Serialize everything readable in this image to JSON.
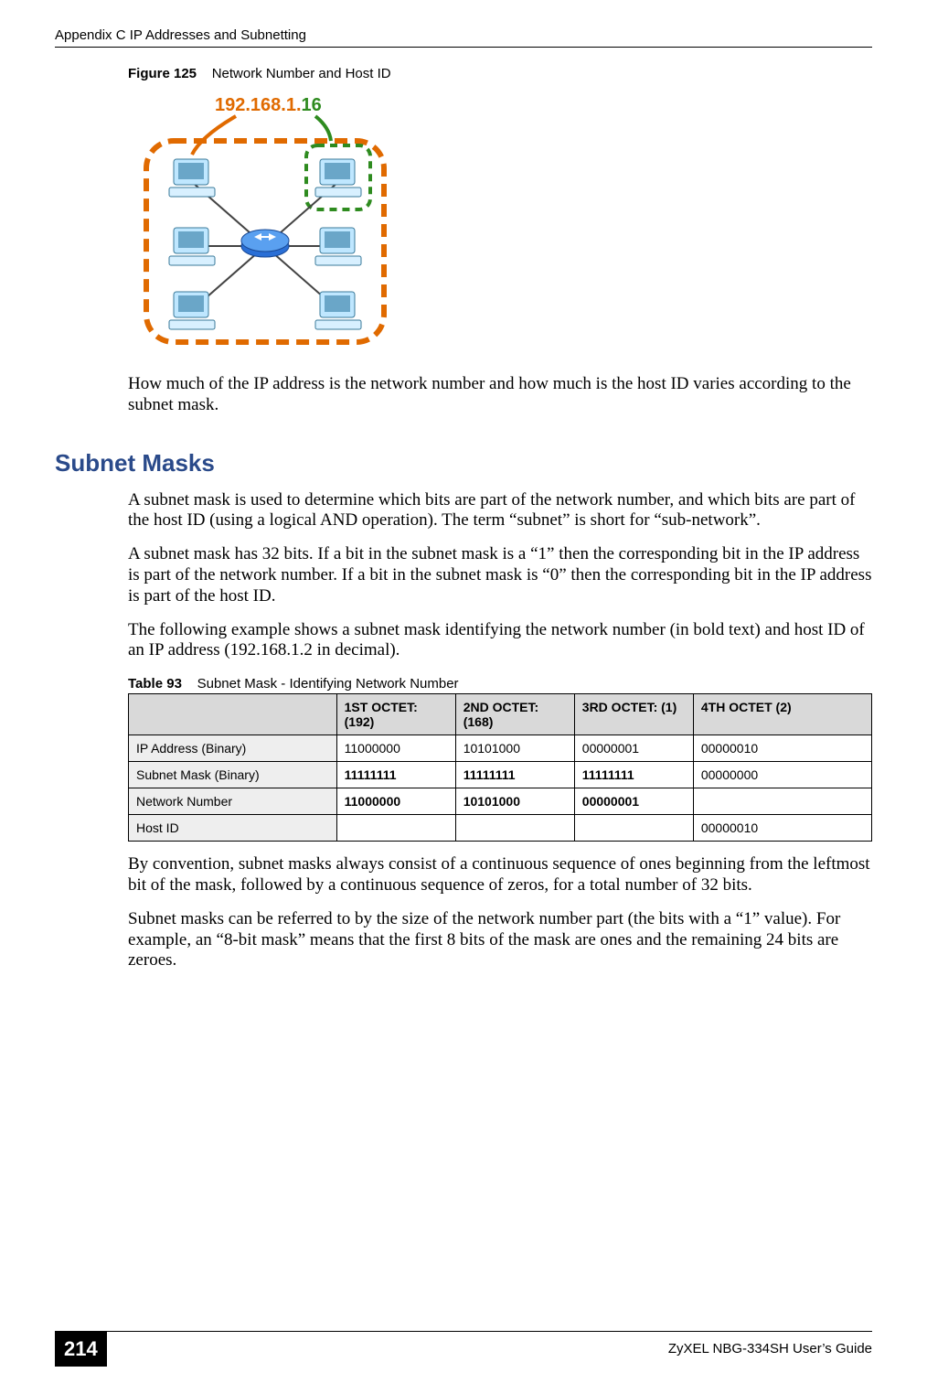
{
  "header": {
    "running_title": "Appendix C IP Addresses and Subnetting"
  },
  "figure": {
    "label": "Figure 125",
    "title": "Network Number and Host ID",
    "ip_label": "192.168.1.16",
    "ip_network_part": "192.168.1.",
    "ip_host_part": "16"
  },
  "paragraphs": {
    "p1": "How much of the IP address is the network number and how much is the host ID varies according to the subnet mask.",
    "h2": "Subnet Masks",
    "p2": "A subnet mask is used to determine which bits are part of the network number, and which bits are part of the host ID (using a logical AND operation). The term “subnet” is short for “sub-network”.",
    "p3": "A subnet mask has 32 bits. If a bit in the subnet mask is a “1” then the corresponding bit in the IP address is part of the network number. If a bit in the subnet mask is “0” then the corresponding bit in the IP address is part of the host ID.",
    "p4": "The following example shows a subnet mask identifying the network number (in bold text) and host ID of an IP address (192.168.1.2 in decimal).",
    "p5": "By convention, subnet masks always consist of a continuous sequence of ones beginning from the leftmost bit of the mask, followed by a continuous sequence of zeros, for a total number of 32 bits.",
    "p6": "Subnet masks can be referred to by the size of the network number part (the bits with a “1” value). For example, an “8-bit mask” means that the first 8 bits of the mask are ones and the remaining 24 bits are zeroes."
  },
  "table": {
    "label": "Table 93",
    "title": "Subnet Mask - Identifying Network Number",
    "headers": {
      "c0": "",
      "c1": "1ST OCTET: (192)",
      "c2": "2ND OCTET: (168)",
      "c3": "3RD OCTET: (1)",
      "c4": "4TH OCTET (2)"
    },
    "rows": {
      "r1": {
        "label": "IP Address (Binary)",
        "c1": "11000000",
        "c2": "10101000",
        "c3": "00000001",
        "c4": "00000010"
      },
      "r2": {
        "label": "Subnet Mask (Binary)",
        "c1": "11111111",
        "c2": "11111111",
        "c3": "11111111",
        "c4": "00000000"
      },
      "r3": {
        "label": "Network Number",
        "c1": "11000000",
        "c2": "10101000",
        "c3": "00000001",
        "c4": ""
      },
      "r4": {
        "label": "Host ID",
        "c1": "",
        "c2": "",
        "c3": "",
        "c4": "00000010"
      }
    }
  },
  "footer": {
    "page_number": "214",
    "guide": "ZyXEL NBG-334SH User’s Guide"
  },
  "chart_data": {
    "type": "table",
    "title": "Subnet Mask - Identifying Network Number",
    "columns": [
      "",
      "1ST OCTET: (192)",
      "2ND OCTET: (168)",
      "3RD OCTET: (1)",
      "4TH OCTET (2)"
    ],
    "rows": [
      [
        "IP Address (Binary)",
        "11000000",
        "10101000",
        "00000001",
        "00000010"
      ],
      [
        "Subnet Mask (Binary)",
        "11111111",
        "11111111",
        "11111111",
        "00000000"
      ],
      [
        "Network Number",
        "11000000",
        "10101000",
        "00000001",
        ""
      ],
      [
        "Host ID",
        "",
        "",
        "",
        "00000010"
      ]
    ]
  }
}
